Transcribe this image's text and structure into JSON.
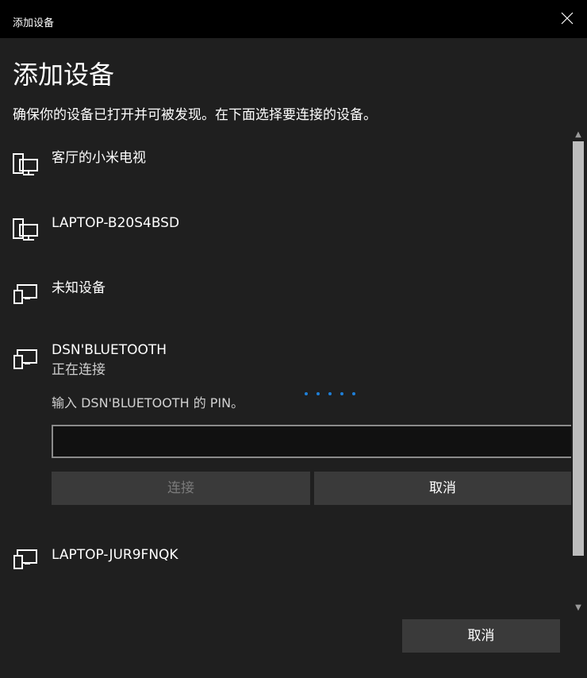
{
  "window": {
    "title": "添加设备"
  },
  "heading": "添加设备",
  "subtitle": "确保你的设备已打开并可被发现。在下面选择要连接的设备。",
  "devices": [
    {
      "name": "客厅的小米电视",
      "icon": "desktop-icon"
    },
    {
      "name": "LAPTOP-B20S4BSD",
      "icon": "desktop-icon"
    },
    {
      "name": "未知设备",
      "icon": "device-icon"
    },
    {
      "name": "DSN'BLUETOOTH",
      "status": "正在连接",
      "icon": "device-icon"
    },
    {
      "name": "LAPTOP-JUR9FNQK",
      "icon": "device-icon"
    }
  ],
  "pin": {
    "prompt": "输入 DSN'BLUETOOTH 的 PIN。",
    "input_value": "",
    "connect_label": "连接",
    "cancel_label": "取消"
  },
  "footer": {
    "cancel_label": "取消"
  },
  "colors": {
    "accent": "#1e7fd8",
    "background": "#1f1f1f",
    "titlebar": "#000000"
  }
}
